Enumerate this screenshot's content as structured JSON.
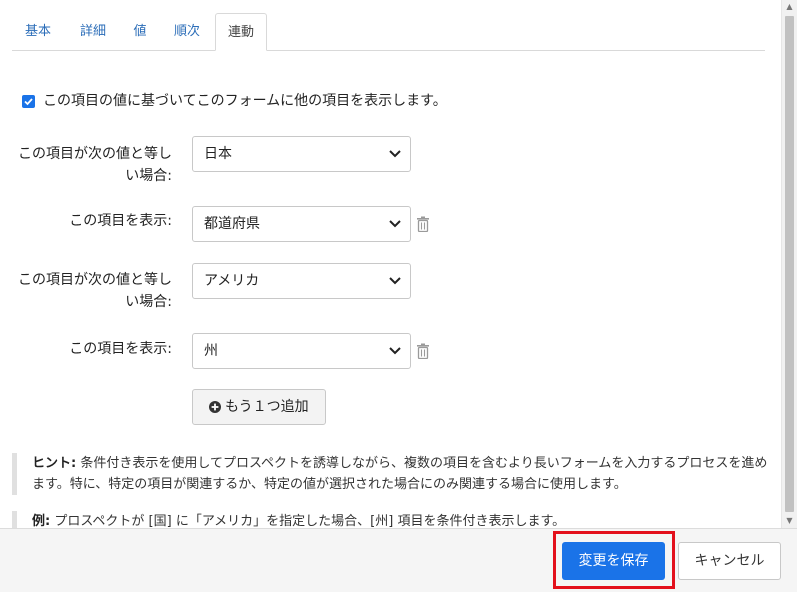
{
  "tabs": [
    "基本",
    "詳細",
    "値",
    "順次",
    "連動"
  ],
  "active_tab": "連動",
  "checkbox": {
    "checked": true,
    "label": "この項目の値に基づいてこのフォームに他の項目を表示します。"
  },
  "rules": [
    {
      "condition_label_l1": "この項目が次の値と等し",
      "condition_label_l2": "い場合:",
      "condition_value": "日本",
      "show_label": "この項目を表示:",
      "show_value": "都道府県"
    },
    {
      "condition_label_l1": "この項目が次の値と等し",
      "condition_label_l2": "い場合:",
      "condition_value": "アメリカ",
      "show_label": "この項目を表示:",
      "show_value": "州"
    }
  ],
  "add_button": "もう１つ追加",
  "hint": {
    "prefix": "ヒント:",
    "text": " 条件付き表示を使用してプロスペクトを誘導しながら、複数の項目を含むより長いフォームを入力するプロセスを進めます。特に、特定の項目が関連するか、特定の値が選択された場合にのみ関連する場合に使用します。"
  },
  "example": {
    "prefix": "例:",
    "text": " プロスペクトが [国] に「アメリカ」を指定した場合、[州] 項目を条件付き表示します。"
  },
  "footer": {
    "save": "変更を保存",
    "cancel": "キャンセル"
  },
  "colors": {
    "accent": "#1a73e8",
    "tab_link": "#2b6db8",
    "highlight": "#e3101c"
  }
}
